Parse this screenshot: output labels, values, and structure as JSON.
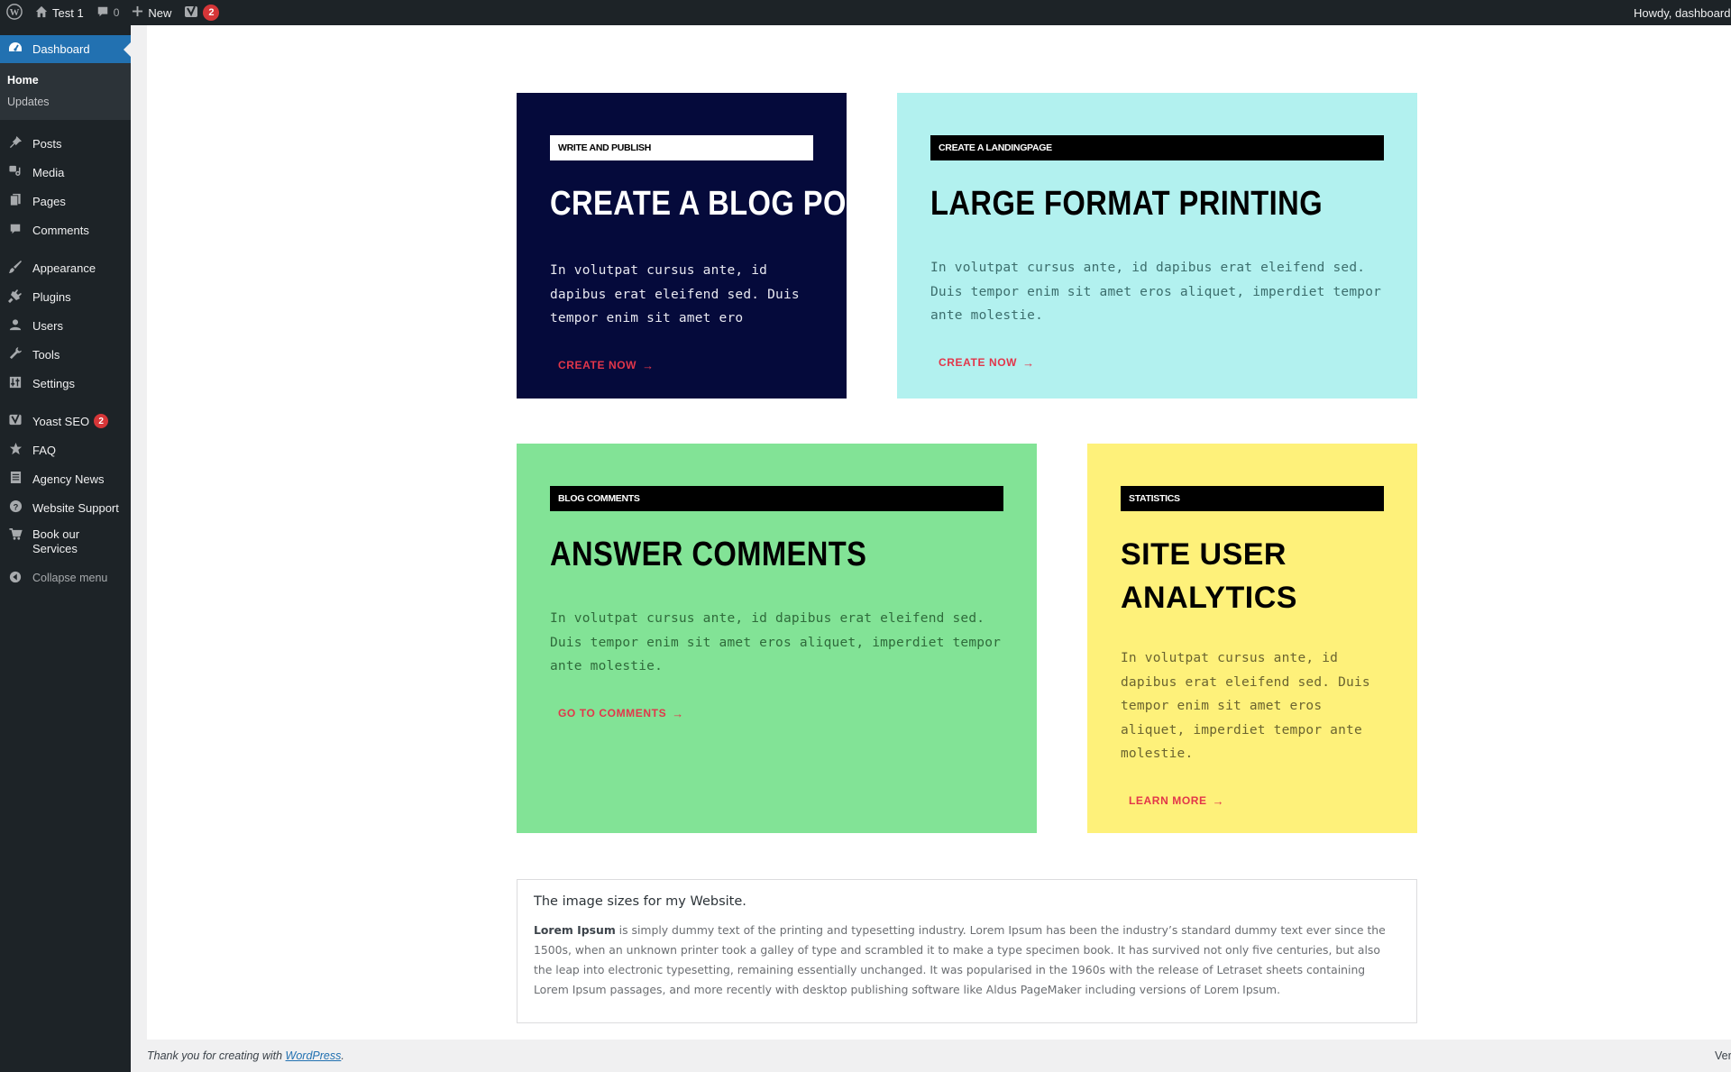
{
  "adminbar": {
    "wp_logo_icon": "wordpress-logo-icon",
    "site_name": "Test 1",
    "comments_count": "0",
    "new_label": "New",
    "yoast_badge": "2",
    "howdy": "Howdy, dashboard"
  },
  "sidebar": {
    "dashboard": {
      "label": "Dashboard",
      "icon": "dashboard-icon"
    },
    "submenu": [
      {
        "label": "Home",
        "current": true
      },
      {
        "label": "Updates",
        "current": false
      }
    ],
    "items": [
      {
        "label": "Posts",
        "icon": "pushpin-icon"
      },
      {
        "label": "Media",
        "icon": "media-icon"
      },
      {
        "label": "Pages",
        "icon": "pages-icon"
      },
      {
        "label": "Comments",
        "icon": "comment-icon"
      },
      {
        "label": "Appearance",
        "icon": "paintbrush-icon"
      },
      {
        "label": "Plugins",
        "icon": "plugin-icon"
      },
      {
        "label": "Users",
        "icon": "user-icon"
      },
      {
        "label": "Tools",
        "icon": "wrench-icon"
      },
      {
        "label": "Settings",
        "icon": "settings-icon"
      },
      {
        "label": "Yoast SEO",
        "icon": "yoast-icon",
        "badge": "2"
      },
      {
        "label": "FAQ",
        "icon": "star-icon"
      },
      {
        "label": "Agency News",
        "icon": "newspaper-icon"
      },
      {
        "label": "Website Support",
        "icon": "help-icon"
      },
      {
        "label": "Book our Services",
        "icon": "cart-icon"
      }
    ],
    "collapse_label": "Collapse menu"
  },
  "cards": [
    {
      "chip": "Write and publish",
      "title": "Create a Blog Post",
      "body": "In volutpat cursus ante, id dapibus erat eleifend sed. Duis tempor enim sit amet ero",
      "cta": "Create now",
      "bg": "#050a3b"
    },
    {
      "chip": "Create a Landingpage",
      "title": "Large Format Printing",
      "body": "In volutpat cursus ante, id dapibus erat eleifend sed. Duis tempor enim sit amet eros aliquet, imperdiet tempor ante molestie.",
      "cta": "Create now",
      "bg": "#b2f1ef"
    },
    {
      "chip": "Blog comments",
      "title": "Answer Comments",
      "body": "In volutpat cursus ante, id dapibus erat eleifend sed. Duis tempor enim sit amet eros aliquet, imperdiet tempor ante molestie.",
      "cta": "Go to comments",
      "bg": "#82e396"
    },
    {
      "chip": "Statistics",
      "title": "Site User Analytics",
      "body": "In volutpat cursus ante, id dapibus erat eleifend sed. Duis tempor enim sit amet eros aliquet, imperdiet tempor ante molestie.",
      "cta": "Learn more",
      "bg": "#fef17a"
    }
  ],
  "cta_arrow": "→",
  "cta_color": "#e2364a",
  "infobox": {
    "title": "The image sizes for my Website.",
    "body_bold": "Lorem Ipsum",
    "body_rest": " is simply dummy text of the printing and typesetting industry. Lorem Ipsum has been the industry’s standard dummy text ever since the 1500s, when an unknown printer took a galley of type and scrambled it to make a type specimen book. It has survived not only five centuries, but also the leap into electronic typesetting, remaining essentially unchanged. It was popularised in the 1960s with the release of Letraset sheets containing Lorem Ipsum passages, and more recently with desktop publishing software like Aldus PageMaker including versions of Lorem Ipsum."
  },
  "footer": {
    "thanks_prefix": "Thank you for creating with ",
    "link_label": "WordPress",
    "thanks_suffix": ".",
    "version_partial": "Ver"
  }
}
